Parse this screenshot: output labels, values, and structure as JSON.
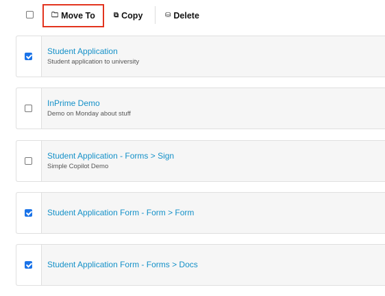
{
  "toolbar": {
    "move_label": "Move To",
    "copy_label": "Copy",
    "delete_label": "Delete",
    "icons": {
      "move": "folder-icon",
      "copy": "copy-icon",
      "delete": "database-icon"
    }
  },
  "items": [
    {
      "title": "Student Application",
      "description": "Student application to university",
      "checked": true
    },
    {
      "title": "InPrime Demo",
      "description": "Demo on Monday about stuff",
      "checked": false
    },
    {
      "title": "Student Application - Forms > Sign",
      "description": "Simple Copilot Demo",
      "checked": false
    },
    {
      "title": "Student Application Form - Form > Form",
      "description": "",
      "checked": true
    },
    {
      "title": "Student Application Form - Forms > Docs",
      "description": "",
      "checked": true
    }
  ],
  "colors": {
    "link": "#1390c8",
    "highlight": "#e2321c",
    "checkbox": "#1a73e8"
  }
}
